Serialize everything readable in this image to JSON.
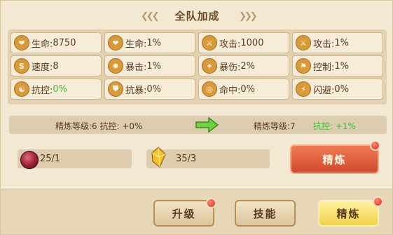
{
  "title": "全队加成",
  "stats": [
    {
      "icon": "heart-icon",
      "glyph": "❤",
      "label": "生命:",
      "value": "8750"
    },
    {
      "icon": "heart-icon",
      "glyph": "❤",
      "label": "生命:",
      "value": "1%"
    },
    {
      "icon": "sword-icon",
      "glyph": "⚔",
      "label": "攻击:",
      "value": "1000"
    },
    {
      "icon": "sword-icon",
      "glyph": "⚔",
      "label": "攻击:",
      "value": "1%"
    },
    {
      "icon": "speed-icon",
      "glyph": "S",
      "label": "速度:",
      "value": "8"
    },
    {
      "icon": "crit-icon",
      "glyph": "✸",
      "label": "暴击:",
      "value": "1%"
    },
    {
      "icon": "crit-damage-icon",
      "glyph": "✦",
      "label": "暴伤:",
      "value": "2%"
    },
    {
      "icon": "control-icon",
      "glyph": "⚑",
      "label": "控制:",
      "value": "1%"
    },
    {
      "icon": "control-resist-icon",
      "glyph": "☯",
      "label": "抗控:",
      "value": "0%",
      "value_color": "#3fbf3a"
    },
    {
      "icon": "crit-resist-icon",
      "glyph": "⛊",
      "label": "抗暴:",
      "value": "0%"
    },
    {
      "icon": "accuracy-icon",
      "glyph": "◎",
      "label": "命中:",
      "value": "0%"
    },
    {
      "icon": "dodge-icon",
      "glyph": "⚡",
      "label": "闪避:",
      "value": "0%"
    }
  ],
  "refine": {
    "current": "精炼等级:6 抗控: +0%",
    "next_level": "精炼等级:7",
    "next_stat": "抗控: +1%"
  },
  "resources": [
    {
      "icon": "red-orb-icon",
      "value": "25/1"
    },
    {
      "icon": "gold-crystal-icon",
      "value": "35/3"
    }
  ],
  "refine_button": "精炼",
  "tabs": [
    {
      "label": "升级",
      "active": false
    },
    {
      "label": "技能",
      "active": false
    },
    {
      "label": "精炼",
      "active": true
    }
  ],
  "colors": {
    "accent_green": "#3fbf3a",
    "button_red": "#e0623f",
    "tab_active": "#f4d94e",
    "notify_red": "#d7261a"
  }
}
